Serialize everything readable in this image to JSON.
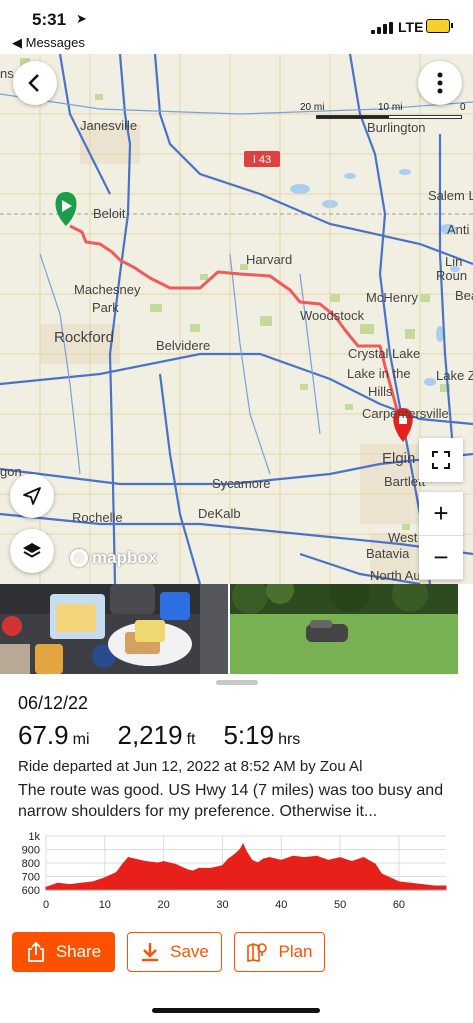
{
  "status": {
    "time": "5:31",
    "back_app": "◀ Messages",
    "network": "LTE"
  },
  "map": {
    "scale": {
      "left": "20 mi",
      "mid": "10 mi",
      "right": "0"
    },
    "road_shield": "I 43",
    "places": [
      "Janesville",
      "Burlington",
      "Salem L",
      "Anti",
      "Beloit",
      "Harvard",
      "Lin",
      "Roun",
      "Machesney",
      "Park",
      "McHenry",
      "Bea",
      "Woodstock",
      "Rockford",
      "Belvidere",
      "Crystal Lake",
      "Lake in the",
      "Hills",
      "Lake Z",
      "Carpentersville",
      "Elgin",
      "Bartlett",
      "gon",
      "Sycamore",
      "Rochelle",
      "DeKalb",
      "West",
      "Batavia",
      "North Aurora",
      "ns"
    ],
    "attribution": "mapbox",
    "zoom_in": "+",
    "zoom_out": "−"
  },
  "ride": {
    "date": "06/12/22",
    "distance_value": "67.9",
    "distance_unit": "mi",
    "elevation_value": "2,219",
    "elevation_unit": "ft",
    "time_value": "5:19",
    "time_unit": "hrs",
    "departed": "Ride departed at Jun 12, 2022 at 8:52 AM by Zou Al",
    "description": "The route was good.  US Hwy 14 (7 miles) was too busy and narrow shoulders for my preference.   Otherwise it..."
  },
  "chart_data": {
    "type": "area",
    "title": "",
    "xlabel": "",
    "ylabel": "",
    "x_ticks": [
      "0",
      "10",
      "20",
      "30",
      "40",
      "50",
      "60"
    ],
    "y_ticks": [
      "600",
      "700",
      "800",
      "900",
      "1k"
    ],
    "xlim": [
      0,
      68
    ],
    "ylim": [
      600,
      1000
    ],
    "grid": true,
    "color": "#e8201a",
    "x": [
      0,
      2,
      4,
      6,
      8,
      10,
      12,
      13,
      14,
      15,
      17,
      19,
      20,
      22,
      24,
      25,
      26,
      28,
      29,
      30,
      31,
      32,
      33,
      33.5,
      34,
      35,
      36,
      37,
      38,
      40,
      42,
      44,
      46,
      48,
      50,
      52,
      54,
      56,
      57,
      58,
      59,
      60,
      62,
      64,
      66,
      68
    ],
    "values": [
      620,
      650,
      640,
      650,
      660,
      690,
      730,
      790,
      840,
      830,
      810,
      800,
      810,
      790,
      750,
      740,
      760,
      760,
      770,
      780,
      830,
      860,
      900,
      940,
      890,
      820,
      800,
      830,
      840,
      820,
      850,
      840,
      850,
      820,
      840,
      810,
      840,
      790,
      720,
      700,
      680,
      660,
      650,
      640,
      630,
      630
    ]
  },
  "actions": {
    "share": "Share",
    "save": "Save",
    "plan": "Plan"
  },
  "colors": {
    "accent": "#fc5200",
    "route": "#f05a5a",
    "start_marker": "#1a9e4a",
    "end_marker": "#e8201a"
  }
}
